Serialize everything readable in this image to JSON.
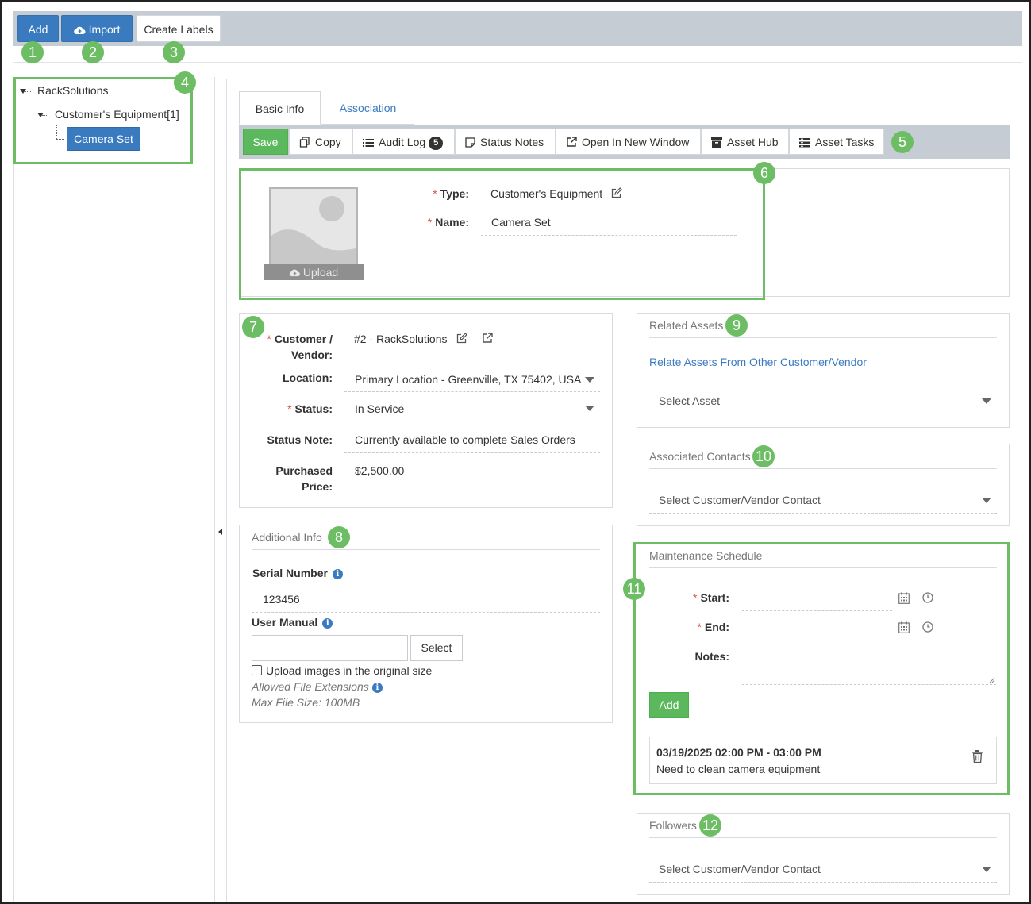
{
  "toolbar": {
    "add_label": "Add",
    "import_label": "Import",
    "create_labels_label": "Create Labels"
  },
  "callouts": [
    "1",
    "2",
    "3",
    "4",
    "5",
    "6",
    "7",
    "8",
    "9",
    "10",
    "11",
    "12"
  ],
  "tree": {
    "root": "RackSolutions",
    "child": "Customer's Equipment[1]",
    "selected": "Camera Set"
  },
  "tabs": {
    "basic_info": "Basic Info",
    "association": "Association"
  },
  "actions": {
    "save": "Save",
    "copy": "Copy",
    "audit_log": "Audit Log",
    "audit_log_count": "5",
    "status_notes": "Status Notes",
    "open_new_window": "Open In New Window",
    "asset_hub": "Asset Hub",
    "asset_tasks": "Asset Tasks"
  },
  "header": {
    "upload_label": "Upload",
    "type_label": "Type:",
    "type_value": "Customer's Equipment",
    "name_label": "Name:",
    "name_value": "Camera Set"
  },
  "details": {
    "customer_label_1": "Customer /",
    "customer_label_2": "Vendor:",
    "customer_value": "#2 - RackSolutions",
    "location_label": "Location:",
    "location_value": "Primary Location - Greenville, TX 75402, USA",
    "status_label": "Status:",
    "status_value": "In Service",
    "status_note_label": "Status Note:",
    "status_note_value": "Currently available to complete Sales Orders",
    "price_label_1": "Purchased",
    "price_label_2": "Price:",
    "price_value": "$2,500.00"
  },
  "additional_info": {
    "title": "Additional Info",
    "serial_label": "Serial Number",
    "serial_value": "123456",
    "manual_label": "User Manual",
    "file_value": "",
    "select_label": "Select",
    "upload_original": "Upload images in the original size",
    "allowed_ext": "Allowed File Extensions",
    "max_size": "Max File Size: 100MB"
  },
  "related_assets": {
    "title": "Related Assets",
    "link": "Relate Assets From Other Customer/Vendor",
    "select_placeholder": "Select Asset"
  },
  "associated_contacts": {
    "title": "Associated Contacts",
    "select_placeholder": "Select Customer/Vendor Contact"
  },
  "maintenance": {
    "title": "Maintenance Schedule",
    "start_label": "Start:",
    "end_label": "End:",
    "notes_label": "Notes:",
    "add_label": "Add",
    "entry_time": "03/19/2025 02:00 PM - 03:00 PM",
    "entry_note": "Need to clean camera equipment"
  },
  "followers": {
    "title": "Followers",
    "select_placeholder": "Select Customer/Vendor Contact"
  },
  "colors": {
    "accent_blue": "#3a7bc0",
    "callout_green": "#6cbd63",
    "save_green": "#5cb85c",
    "toolbar_gray": "#c5ccd4",
    "required_red": "#d9534f"
  }
}
